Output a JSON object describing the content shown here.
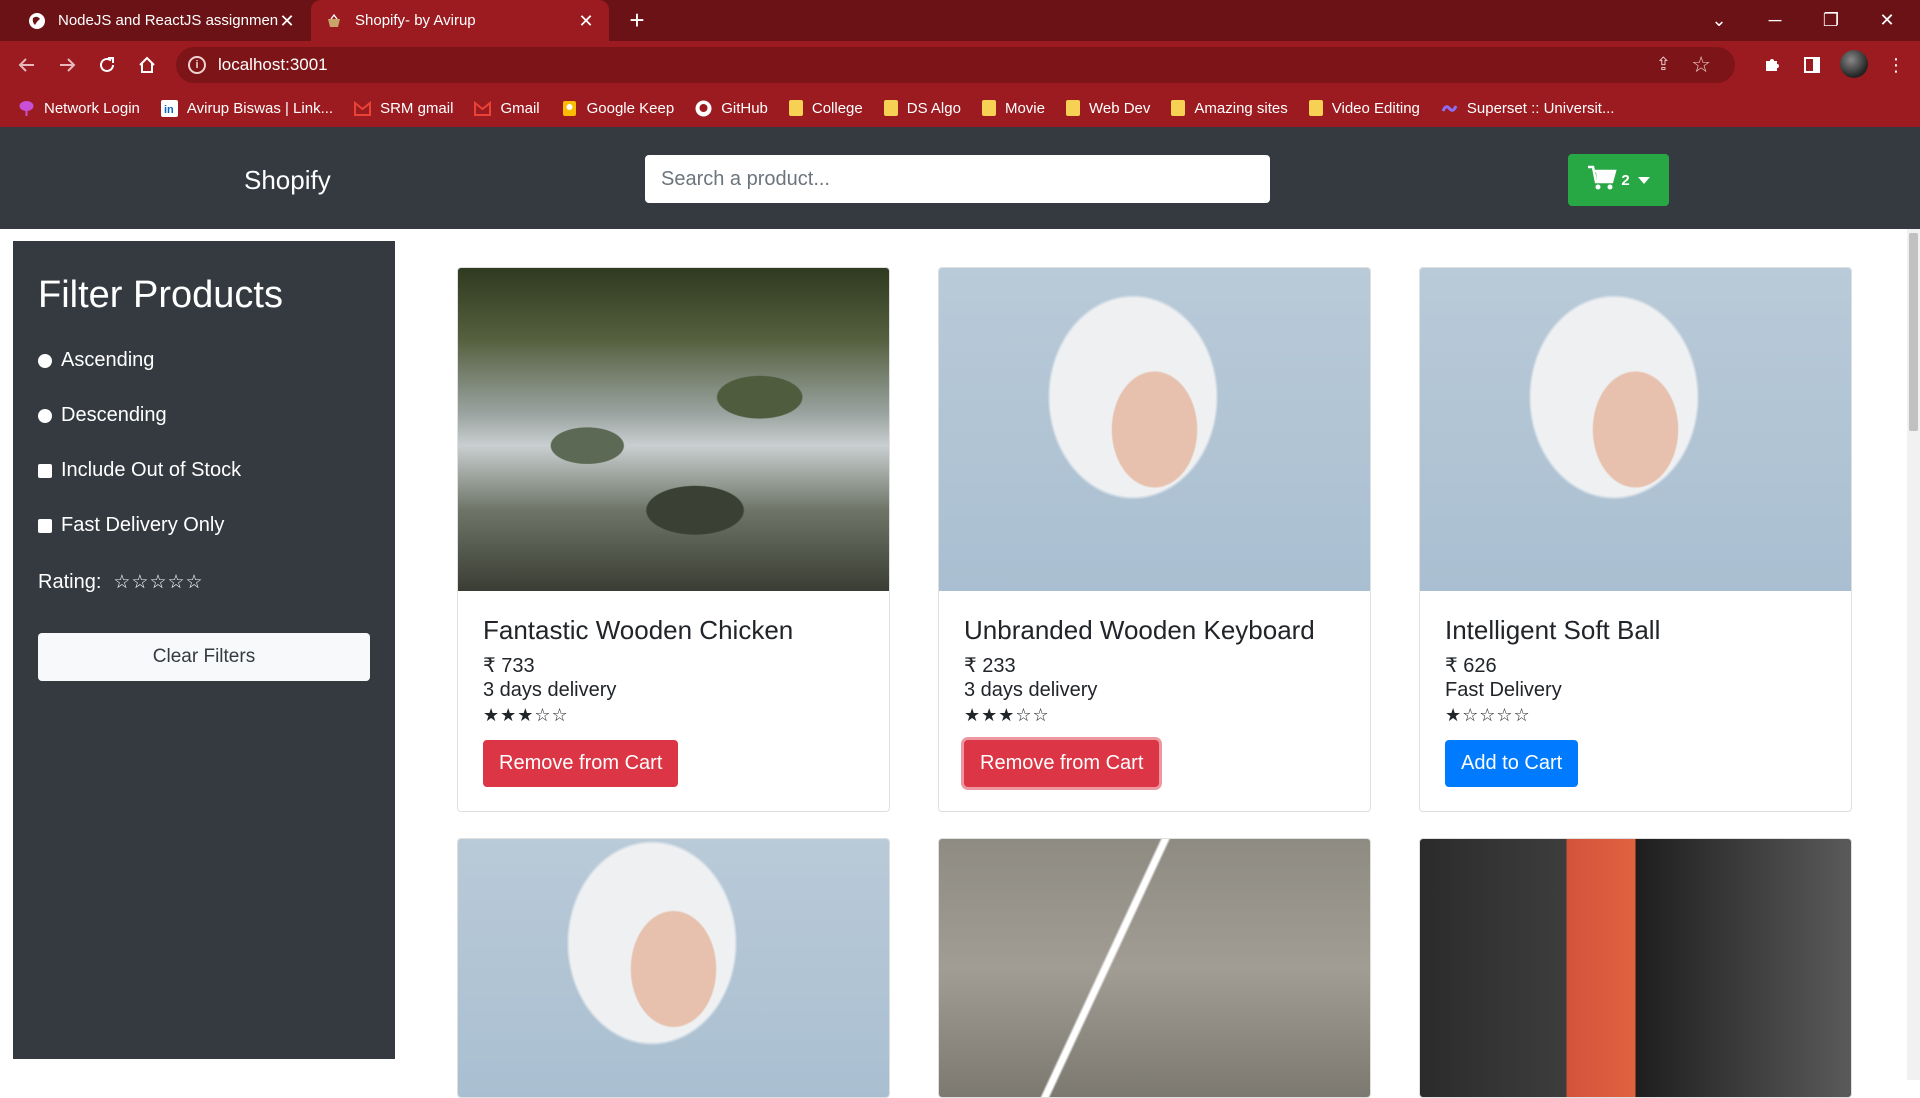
{
  "browser": {
    "tabs": [
      {
        "title": "NodeJS and ReactJS assignment...",
        "close": "✕"
      },
      {
        "title": "Shopify- by Avirup",
        "close": "✕"
      }
    ],
    "new_tab": "+",
    "url": "localhost:3001",
    "window_controls": {
      "tab_search": "⌄",
      "minimize": "─",
      "restore": "❐",
      "close": "✕"
    },
    "bookmarks": [
      {
        "label": "Network Login",
        "icon": "network-icon",
        "color": "#c94fd6"
      },
      {
        "label": "Avirup Biswas | Link...",
        "icon": "linkedin-icon",
        "color": "#0a66c2"
      },
      {
        "label": "SRM gmail",
        "icon": "gmail-icon",
        "color": "#ea4335"
      },
      {
        "label": "Gmail",
        "icon": "gmail-icon",
        "color": "#ea4335"
      },
      {
        "label": "Google Keep",
        "icon": "keep-icon",
        "color": "#fbbc04"
      },
      {
        "label": "GitHub",
        "icon": "github-icon",
        "color": "#ffffff"
      },
      {
        "label": "College",
        "icon": "folder-icon",
        "color": "#f7d154"
      },
      {
        "label": "DS Algo",
        "icon": "folder-icon",
        "color": "#f7d154"
      },
      {
        "label": "Movie",
        "icon": "folder-icon",
        "color": "#f7d154"
      },
      {
        "label": "Web Dev",
        "icon": "folder-icon",
        "color": "#f7d154"
      },
      {
        "label": "Amazing sites",
        "icon": "folder-icon",
        "color": "#f7d154"
      },
      {
        "label": "Video Editing",
        "icon": "folder-icon",
        "color": "#f7d154"
      },
      {
        "label": "Superset :: Universit...",
        "icon": "superset-icon",
        "color": "#8c6ff0"
      }
    ]
  },
  "navbar": {
    "brand": "Shopify",
    "search_placeholder": "Search a product...",
    "cart_count": "2"
  },
  "sidebar": {
    "title": "Filter Products",
    "options": {
      "ascending": "Ascending",
      "descending": "Descending",
      "include_out_of_stock": "Include Out of Stock",
      "fast_delivery_only": "Fast Delivery Only"
    },
    "rating_label": "Rating:",
    "rating_stars": "☆☆☆☆☆",
    "clear_button": "Clear Filters"
  },
  "products": [
    {
      "name": "Fantastic Wooden Chicken",
      "price": "₹ 733",
      "delivery": "3 days delivery",
      "rating": 3,
      "stars": "★★★☆☆",
      "action": "Remove from Cart"
    },
    {
      "name": "Unbranded Wooden Keyboard",
      "price": "₹ 233",
      "delivery": "3 days delivery",
      "rating": 3,
      "stars": "★★★☆☆",
      "action": "Remove from Cart"
    },
    {
      "name": "Intelligent Soft Ball",
      "price": "₹ 626",
      "delivery": "Fast Delivery",
      "rating": 1,
      "stars": "★☆☆☆☆",
      "action": "Add to Cart"
    }
  ],
  "colors": {
    "tabbar": "#6b1216",
    "toolbar": "#9b1b20",
    "navbar": "#343a40",
    "cart_button": "#28a745",
    "danger": "#dc3545",
    "primary": "#007bff"
  }
}
